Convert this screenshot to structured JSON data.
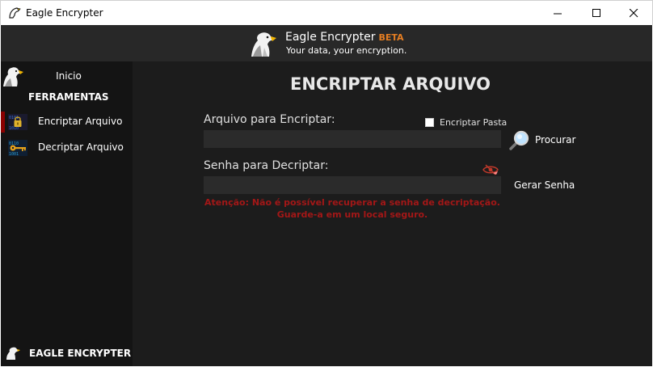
{
  "window": {
    "title": "Eagle Encrypter",
    "controls": {
      "minimize": "minimize-icon",
      "maximize": "maximize-icon",
      "close": "close-icon"
    }
  },
  "header": {
    "brand": "Eagle Encrypter",
    "beta": "BETA",
    "tagline": "Your data, your encryption."
  },
  "sidebar": {
    "home_label": "Inicio",
    "section_title": "FERRAMENTAS",
    "items": [
      {
        "label": "Encriptar Arquivo",
        "icon": "lock-icon",
        "active": true
      },
      {
        "label": "Decriptar Arquivo",
        "icon": "key-icon",
        "active": false
      }
    ],
    "footer": "EAGLE ENCRYPTER"
  },
  "main": {
    "heading": "ENCRIPTAR ARQUIVO",
    "file_label": "Arquivo para Encriptar:",
    "file_value": "",
    "folder_checkbox_label": "Encriptar Pasta",
    "folder_checked": false,
    "browse_label": "Procurar",
    "password_label": "Senha para Decriptar:",
    "password_value": "",
    "generate_label": "Gerar Senha",
    "warning_line1": "Atenção: Não é possível recuperar a senha de decriptação.",
    "warning_line2": "Guarde-a em um local seguro."
  },
  "colors": {
    "header_bg": "#282828",
    "sidebar_bg": "#141414",
    "main_bg": "#1c1c1c",
    "input_bg": "#2b2b2b",
    "beta": "#e67e22",
    "warning": "#a31717",
    "active_marker": "#8b0000"
  }
}
